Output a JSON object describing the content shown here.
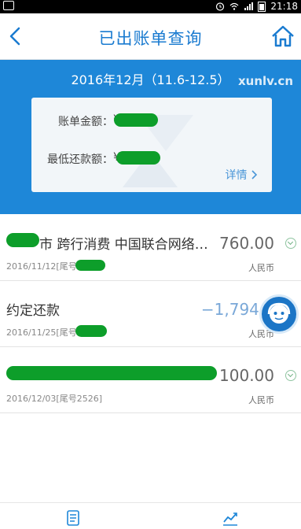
{
  "status_bar": {
    "time": "21:18"
  },
  "nav": {
    "title": "已出账单查询"
  },
  "summary": {
    "period": "2016年12月（11.6-12.5）",
    "watermark": "xunlv.cn",
    "bill_amount_label": "账单金额：",
    "bill_amount_prefix": "¥",
    "min_payment_label": "最低还款额：",
    "min_payment_prefix": "¥",
    "detail_link": "详情"
  },
  "transactions": [
    {
      "description_visible": "市 跨行消费 中国联合网络…",
      "amount": "760.00",
      "date": "2016/11/12",
      "card_suffix_label": "[尾号",
      "currency": "人民币"
    },
    {
      "description_visible": "约定还款",
      "amount": "−1,794.0",
      "date": "2016/11/25",
      "card_suffix_label": "[尾号",
      "currency": "人民币"
    },
    {
      "description_visible": "",
      "amount": "100.00",
      "date": "2016/12/03",
      "card_suffix_label": "[尾号2526]",
      "currency": "人民币"
    }
  ],
  "colors": {
    "brand_blue": "#1e87d8",
    "title_blue": "#1a7bd0",
    "redaction_green": "#0d9e2a"
  },
  "icons": {
    "back": "back-chevron-icon",
    "home": "home-icon",
    "detail": "chevron-right-icon",
    "service": "customer-service-icon",
    "tab_left": "bill-list-icon",
    "tab_right": "trend-chart-icon"
  }
}
